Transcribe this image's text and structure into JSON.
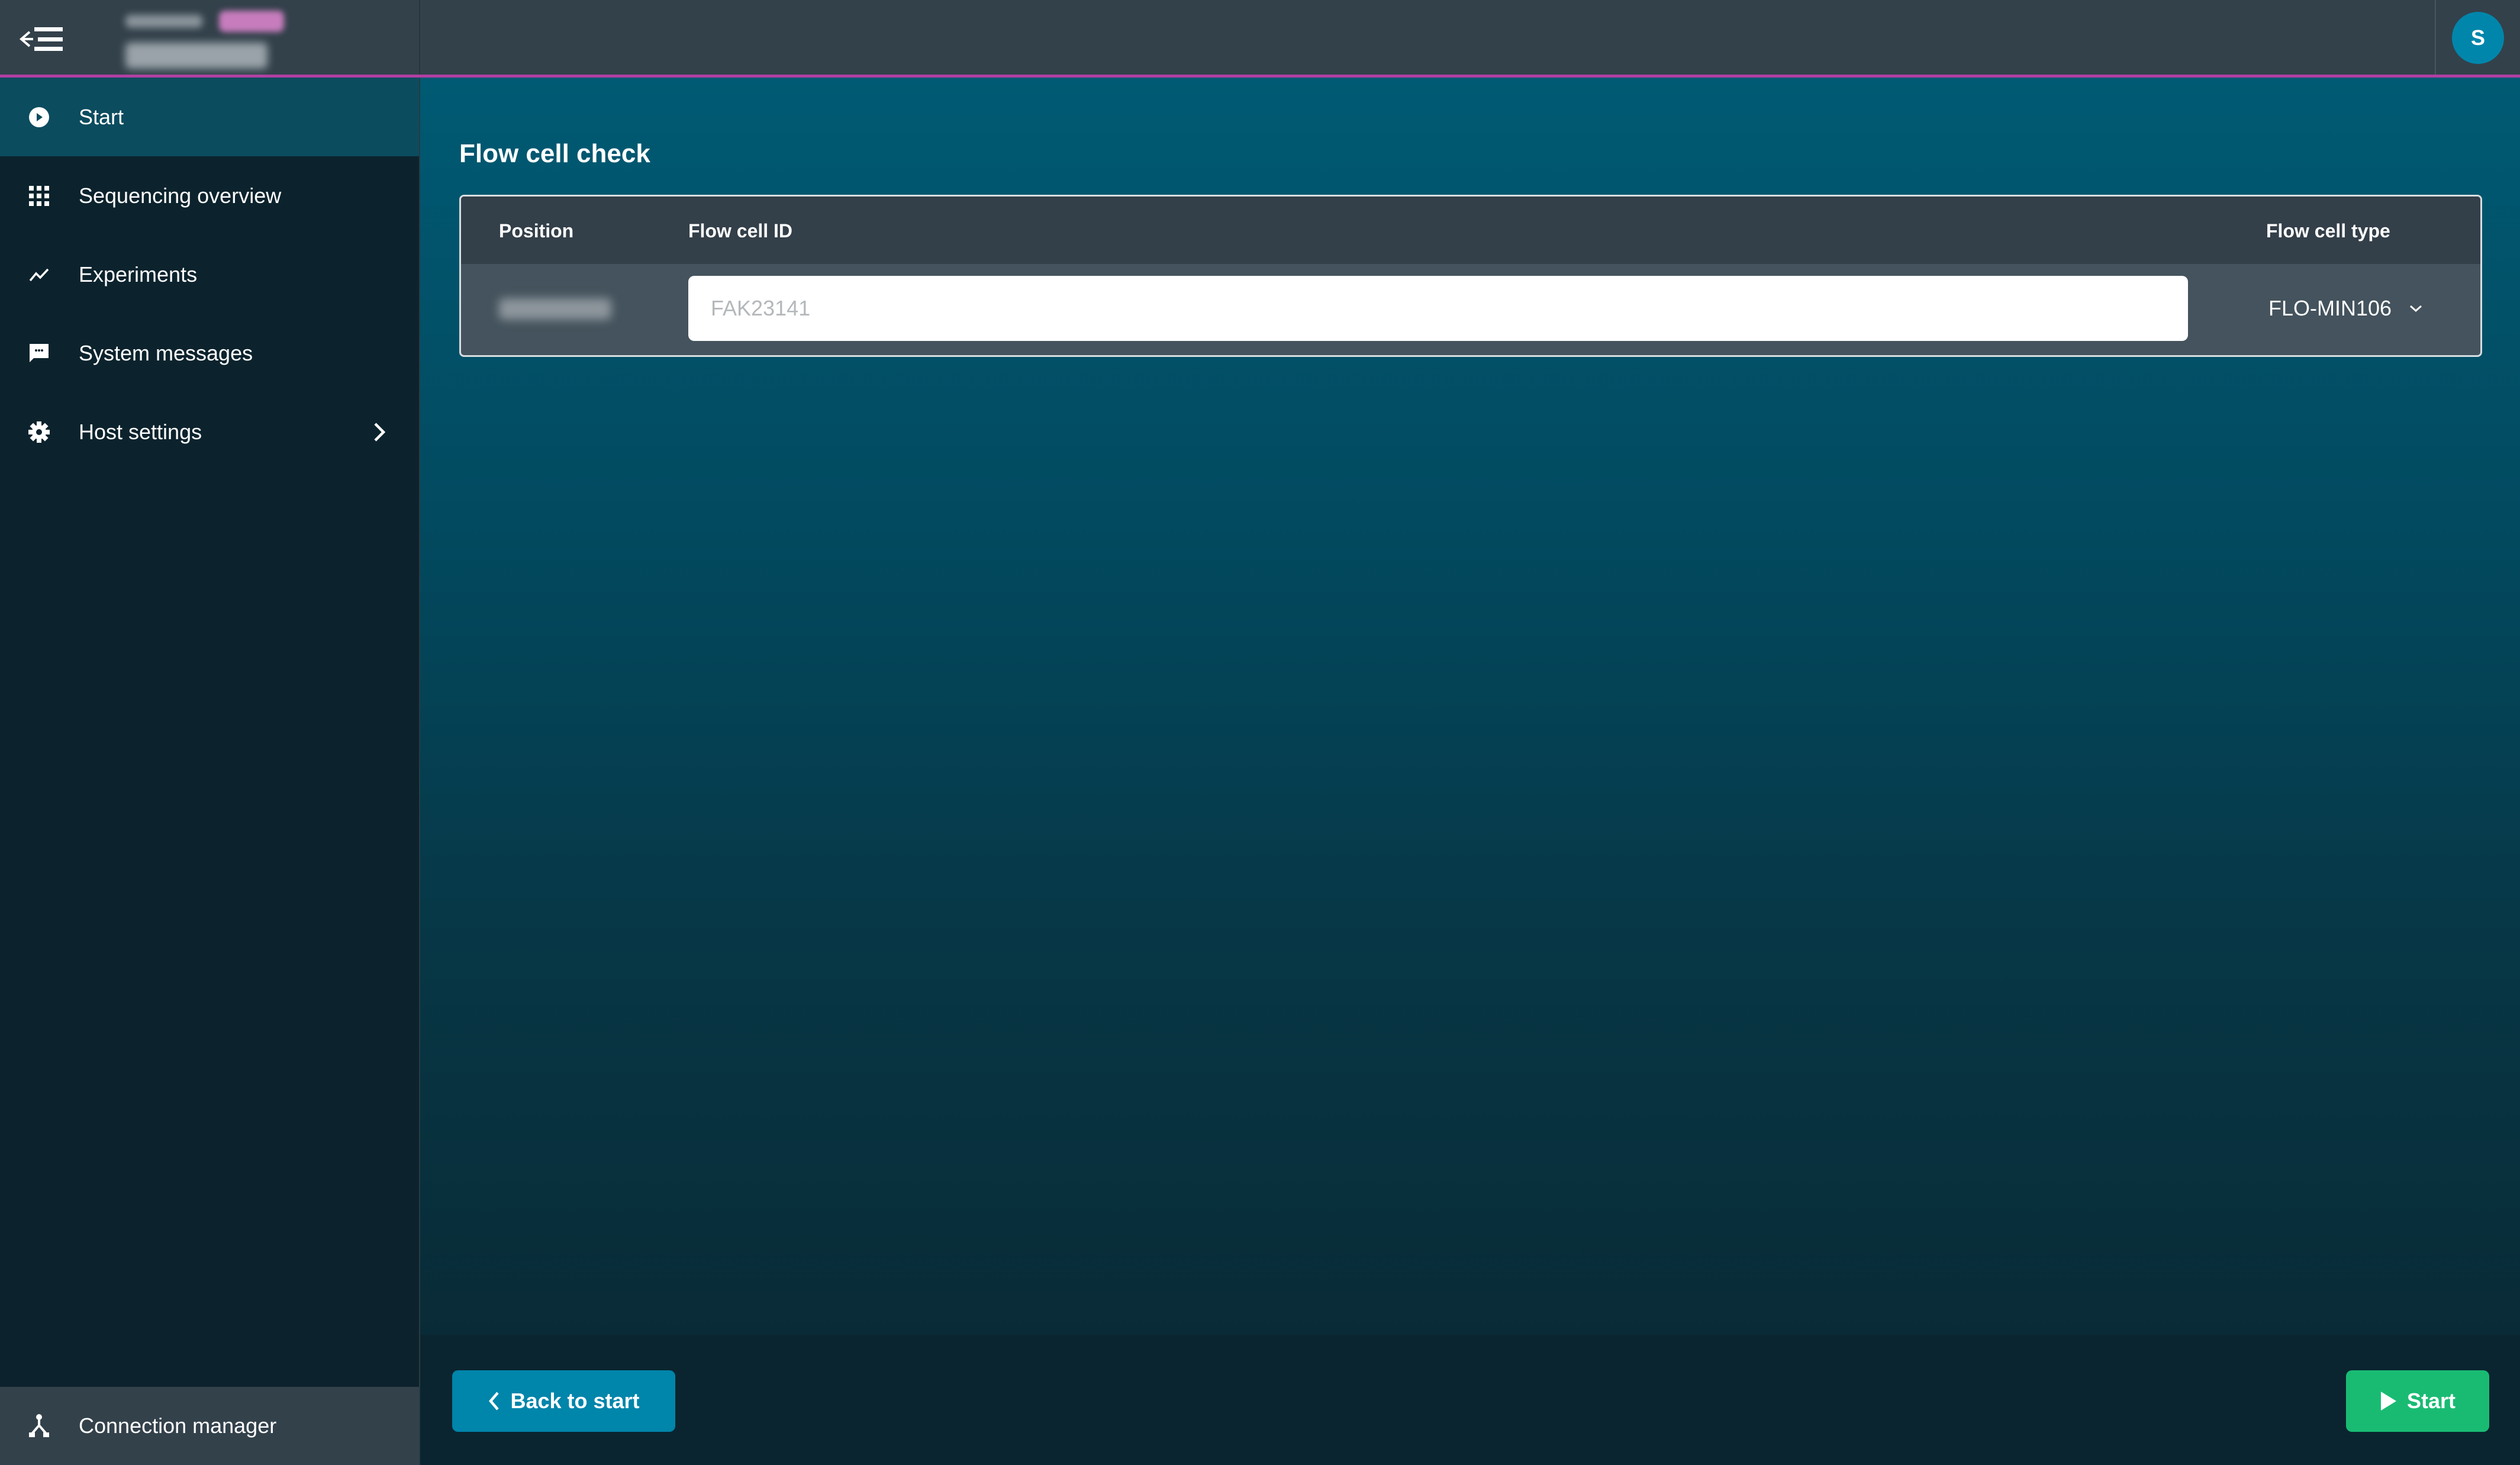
{
  "header": {
    "menu_icon": "collapse-menu-icon",
    "device_label_redacted": true,
    "device_badge_redacted": true,
    "device_name_redacted": true,
    "avatar_initial": "S",
    "colors": {
      "background": "#33414b",
      "accent_line": "#b13fa2",
      "avatar": "#0086ab"
    }
  },
  "sidebar": {
    "items": [
      {
        "label": "Start",
        "icon": "play-circle-icon",
        "active": true
      },
      {
        "label": "Sequencing overview",
        "icon": "grid-icon",
        "active": false
      },
      {
        "label": "Experiments",
        "icon": "trend-line-icon",
        "active": false
      },
      {
        "label": "System messages",
        "icon": "chat-bubble-icon",
        "active": false
      },
      {
        "label": "Host settings",
        "icon": "gear-icon",
        "active": false,
        "has_submenu": true
      }
    ],
    "bottom_item": {
      "label": "Connection manager",
      "icon": "connection-icon"
    },
    "colors": {
      "background": "#0c232d",
      "active": "#0b4c5f",
      "bottom": "#33414b"
    }
  },
  "main": {
    "title": "Flow cell check",
    "table": {
      "columns": [
        "Position",
        "Flow cell ID",
        "Flow cell type"
      ],
      "rows": [
        {
          "position_redacted": true,
          "flow_cell_id_value": "",
          "flow_cell_id_placeholder": "FAK23141",
          "flow_cell_type": "FLO-MIN106"
        }
      ]
    }
  },
  "footer": {
    "back_label": "Back to start",
    "start_label": "Start",
    "colors": {
      "back": "#0085ab",
      "start": "#19bb73"
    }
  }
}
